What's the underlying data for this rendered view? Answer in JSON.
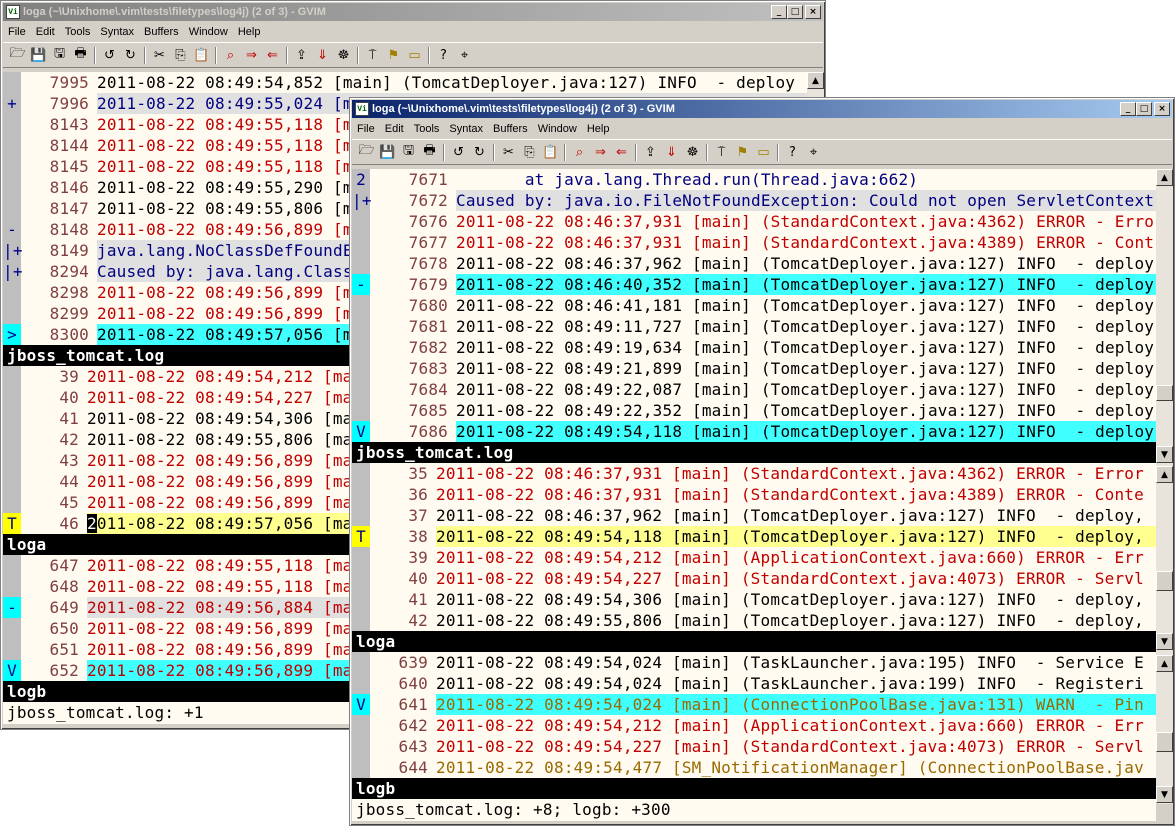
{
  "win1": {
    "title": "loga (~\\Unixhome\\.vim\\tests\\filetypes\\log4j) (2 of 3) - GVIM",
    "menu": [
      "File",
      "Edit",
      "Tools",
      "Syntax",
      "Buffers",
      "Window",
      "Help"
    ],
    "pane1": {
      "lines": [
        {
          "sign": "",
          "num": "7995",
          "text": "2011-08-22 08:49:54,852 [main] (TomcatDeployer.java:127) INFO  - deploy",
          "cls": "blk"
        },
        {
          "sign": "+",
          "num": "7996",
          "text": "2011-08-22 08:49:55,024 [main] (TomcatDeployer.java:127) INFO  - deploy",
          "cls": "blu",
          "bg": "bggr"
        },
        {
          "sign": "",
          "num": "8143",
          "text": "2011-08-22 08:49:55,118 [main] (StandardContext.java:4362) ERROR",
          "cls": "red"
        },
        {
          "sign": "",
          "num": "8144",
          "text": "2011-08-22 08:49:55,118 [main] (StandardContext.java:4389) ERROR",
          "cls": "red"
        },
        {
          "sign": "",
          "num": "8145",
          "text": "2011-08-22 08:49:55,118 [main] (StandardContext.java:4362) ERROR",
          "cls": "red"
        },
        {
          "sign": "",
          "num": "8146",
          "text": "2011-08-22 08:49:55,290 [main] (TomcatDeployer.java:127) INFO",
          "cls": "blk"
        },
        {
          "sign": "",
          "num": "8147",
          "text": "2011-08-22 08:49:55,806 [main] (TomcatDeployer.java:127) INFO",
          "cls": "blk"
        },
        {
          "sign": "-",
          "num": "8148",
          "text": "2011-08-22 08:49:56,899 [main] (ApplicationContext.java:660) ERROR",
          "cls": "red"
        },
        {
          "sign": "|+",
          "num": "8149",
          "text": "java.lang.NoClassDefFoundError: org/apache/",
          "cls": "blu",
          "bg": "bggr"
        },
        {
          "sign": "|+",
          "num": "8294",
          "text": "Caused by: java.lang.ClassNotFoundException",
          "cls": "blu",
          "bg": "bggr"
        },
        {
          "sign": "",
          "num": "8298",
          "text": "2011-08-22 08:49:56,899 [main] (StandardContext.java:4073) ERROR",
          "cls": "red"
        },
        {
          "sign": "",
          "num": "8299",
          "text": "2011-08-22 08:49:56,899 [main] (StandardContext.java:4362) ERROR",
          "cls": "red"
        },
        {
          "sign": ">",
          "num": "8300",
          "text": "2011-08-22 08:49:57,056 [main] (TomcatDeployer.java:127) INFO",
          "cls": "blk",
          "bg": "bgcy",
          "signcls": "cy"
        }
      ],
      "status": "jboss_tomcat.log"
    },
    "pane2": {
      "lines": [
        {
          "sign": "",
          "num": "39",
          "text": "2011-08-22 08:49:54,212 [main] (ApplicationContext.java:660) ERROR",
          "cls": "red"
        },
        {
          "sign": "",
          "num": "40",
          "text": "2011-08-22 08:49:54,227 [main] (StandardContext.java:4073) ERROR",
          "cls": "red"
        },
        {
          "sign": "",
          "num": "41",
          "text": "2011-08-22 08:49:54,306 [main] (TomcatDeployer.java:127) INFO",
          "cls": "blk"
        },
        {
          "sign": "",
          "num": "42",
          "text": "2011-08-22 08:49:55,806 [main] (TomcatDeployer.java:127) INFO",
          "cls": "blk"
        },
        {
          "sign": "",
          "num": "43",
          "text": "2011-08-22 08:49:56,899 [main] (ApplicationContext.java:660) ERROR",
          "cls": "red"
        },
        {
          "sign": "",
          "num": "44",
          "text": "2011-08-22 08:49:56,899 [main] (StandardContext.java:4073) ERROR",
          "cls": "red"
        },
        {
          "sign": "",
          "num": "45",
          "text": "2011-08-22 08:49:56,899 [main] (StandardContext.java:4362) ERROR",
          "cls": "red"
        },
        {
          "sign": "T",
          "num": "46",
          "cursor": "2",
          "text": "011-08-22 08:49:57,056 [main] (TomcatDeployer.java:127) INFO",
          "cls": "blk",
          "bg": "bgyl",
          "signcls": "yl"
        }
      ],
      "status": "loga"
    },
    "pane3": {
      "lines": [
        {
          "sign": "",
          "num": "647",
          "text": "2011-08-22 08:49:55,118 [main] (StandardContext.java:4362) ERROR",
          "cls": "red"
        },
        {
          "sign": "",
          "num": "648",
          "text": "2011-08-22 08:49:55,118 [main] (StandardContext.java:4389) ERROR",
          "cls": "red"
        },
        {
          "sign": "-",
          "num": "649",
          "text": "2011-08-22 08:49:56,884 [main] (StandardContext.java:4362) ERROR",
          "cls": "red",
          "bg": "bggr",
          "signcls": "cy"
        },
        {
          "sign": "",
          "num": "650",
          "text": "2011-08-22 08:49:56,899 [main] (ApplicationContext.java:660) ERROR",
          "cls": "red"
        },
        {
          "sign": "",
          "num": "651",
          "text": "2011-08-22 08:49:56,899 [main] (StandardContext.java:4073) ERROR",
          "cls": "red"
        },
        {
          "sign": "V",
          "num": "652",
          "text": "2011-08-22 08:49:56,899 [main] (StandardContext.java:4362) ERROR",
          "cls": "red",
          "bg": "bgcy",
          "signcls": "cy"
        }
      ],
      "status": "logb"
    },
    "cmdline": "jboss_tomcat.log: +1"
  },
  "win2": {
    "title": "loga (~\\Unixhome\\.vim\\tests\\filetypes\\log4j) (2 of 3) - GVIM",
    "menu": [
      "File",
      "Edit",
      "Tools",
      "Syntax",
      "Buffers",
      "Window",
      "Help"
    ],
    "pane1": {
      "lines": [
        {
          "sign": "2",
          "num": "7671",
          "text": "       at java.lang.Thread.run(Thread.java:662)",
          "cls": "blu"
        },
        {
          "sign": "|+",
          "num": "7672",
          "text": "Caused by: java.io.FileNotFoundException: Could not open ServletContext",
          "cls": "blu",
          "bg": "bggr"
        },
        {
          "sign": "",
          "num": "7676",
          "text": "2011-08-22 08:46:37,931 [main] (StandardContext.java:4362) ERROR - Erro",
          "cls": "red"
        },
        {
          "sign": "",
          "num": "7677",
          "text": "2011-08-22 08:46:37,931 [main] (StandardContext.java:4389) ERROR - Cont",
          "cls": "red"
        },
        {
          "sign": "",
          "num": "7678",
          "text": "2011-08-22 08:46:37,962 [main] (TomcatDeployer.java:127) INFO  - deploy",
          "cls": "blk"
        },
        {
          "sign": "-",
          "num": "7679",
          "text": "2011-08-22 08:46:40,352 [main] (TomcatDeployer.java:127) INFO  - deploy",
          "cls": "blk",
          "bg": "bgcy",
          "signcls": "cy"
        },
        {
          "sign": "",
          "num": "7680",
          "text": "2011-08-22 08:46:41,181 [main] (TomcatDeployer.java:127) INFO  - deploy",
          "cls": "blk"
        },
        {
          "sign": "",
          "num": "7681",
          "text": "2011-08-22 08:49:11,727 [main] (TomcatDeployer.java:127) INFO  - deploy",
          "cls": "blk"
        },
        {
          "sign": "",
          "num": "7682",
          "text": "2011-08-22 08:49:19,634 [main] (TomcatDeployer.java:127) INFO  - deploy",
          "cls": "blk"
        },
        {
          "sign": "",
          "num": "7683",
          "text": "2011-08-22 08:49:21,899 [main] (TomcatDeployer.java:127) INFO  - deploy",
          "cls": "blk"
        },
        {
          "sign": "",
          "num": "7684",
          "text": "2011-08-22 08:49:22,087 [main] (TomcatDeployer.java:127) INFO  - deploy",
          "cls": "blk"
        },
        {
          "sign": "",
          "num": "7685",
          "text": "2011-08-22 08:49:22,352 [main] (TomcatDeployer.java:127) INFO  - deploy",
          "cls": "blk"
        },
        {
          "sign": "V",
          "num": "7686",
          "text": "2011-08-22 08:49:54,118 [main] (TomcatDeployer.java:127) INFO  - deploy",
          "cls": "blk",
          "bg": "bgcy",
          "signcls": "cy"
        }
      ],
      "status": "jboss_tomcat.log"
    },
    "pane2": {
      "lines": [
        {
          "sign": "",
          "num": "35",
          "text": "2011-08-22 08:46:37,931 [main] (StandardContext.java:4362) ERROR - Error",
          "cls": "red"
        },
        {
          "sign": "",
          "num": "36",
          "text": "2011-08-22 08:46:37,931 [main] (StandardContext.java:4389) ERROR - Conte",
          "cls": "red"
        },
        {
          "sign": "",
          "num": "37",
          "text": "2011-08-22 08:46:37,962 [main] (TomcatDeployer.java:127) INFO  - deploy,",
          "cls": "blk"
        },
        {
          "sign": "T",
          "num": "38",
          "text": "2011-08-22 08:49:54,118 [main] (TomcatDeployer.java:127) INFO  - deploy,",
          "cls": "blk",
          "bg": "bgyl",
          "signcls": "yl"
        },
        {
          "sign": "",
          "num": "39",
          "text": "2011-08-22 08:49:54,212 [main] (ApplicationContext.java:660) ERROR - Err",
          "cls": "red"
        },
        {
          "sign": "",
          "num": "40",
          "text": "2011-08-22 08:49:54,227 [main] (StandardContext.java:4073) ERROR - Servl",
          "cls": "red"
        },
        {
          "sign": "",
          "num": "41",
          "text": "2011-08-22 08:49:54,306 [main] (TomcatDeployer.java:127) INFO  - deploy,",
          "cls": "blk"
        },
        {
          "sign": "",
          "num": "42",
          "text": "2011-08-22 08:49:55,806 [main] (TomcatDeployer.java:127) INFO  - deploy,",
          "cls": "blk"
        }
      ],
      "status": "loga"
    },
    "pane3": {
      "lines": [
        {
          "sign": "",
          "num": "639",
          "text": "2011-08-22 08:49:54,024 [main] (TaskLauncher.java:195) INFO  - Service E",
          "cls": "blk"
        },
        {
          "sign": "",
          "num": "640",
          "text": "2011-08-22 08:49:54,024 [main] (TaskLauncher.java:199) INFO  - Registeri",
          "cls": "blk"
        },
        {
          "sign": "V",
          "num": "641",
          "text": "2011-08-22 08:49:54,024 [main] (ConnectionPoolBase.java:131) WARN  - Pin",
          "cls": "brn",
          "bg": "bgcy",
          "signcls": "cy"
        },
        {
          "sign": "",
          "num": "642",
          "text": "2011-08-22 08:49:54,212 [main] (ApplicationContext.java:660) ERROR - Err",
          "cls": "red"
        },
        {
          "sign": "",
          "num": "643",
          "text": "2011-08-22 08:49:54,227 [main] (StandardContext.java:4073) ERROR - Servl",
          "cls": "red"
        },
        {
          "sign": "",
          "num": "644",
          "text": "2011-08-22 08:49:54,477 [SM_NotificationManager] (ConnectionPoolBase.jav",
          "cls": "brn"
        }
      ],
      "status": "logb"
    },
    "cmdline": "jboss_tomcat.log: +8; logb: +300"
  },
  "toolbar_icons": [
    "open-icon",
    "save-icon",
    "save-all-icon",
    "print-icon",
    "undo-icon",
    "redo-icon",
    "cut-icon",
    "copy-icon",
    "paste-icon",
    "find-replace-icon",
    "find-next-icon",
    "find-prev-icon",
    "load-session-icon",
    "save-session-icon",
    "run-script-icon",
    "make-icon",
    "run-ctags-icon",
    "jump-tag-icon",
    "help-icon",
    "find-help-icon"
  ],
  "window_buttons": {
    "minimize": "_",
    "maximize": "□",
    "close": "×"
  },
  "colors": {
    "error": "#c00000",
    "info": "#000000",
    "fold": "#000080",
    "warn": "#9a6a00",
    "sign_cyan": "#40ffff",
    "sign_yellow": "#ffff90"
  }
}
